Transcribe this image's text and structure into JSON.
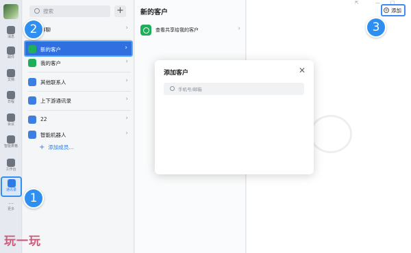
{
  "rail": {
    "items": [
      {
        "label": "消息",
        "icon": "chat-icon"
      },
      {
        "label": "邮件",
        "icon": "mail-icon"
      },
      {
        "label": "文档",
        "icon": "doc-icon"
      },
      {
        "label": "日程",
        "icon": "calendar-icon"
      },
      {
        "label": "会议",
        "icon": "meeting-icon"
      },
      {
        "label": "智能表格",
        "icon": "table-icon"
      },
      {
        "label": "工作台",
        "icon": "grid-icon"
      },
      {
        "label": "通讯录",
        "icon": "contacts-icon"
      }
    ],
    "more_label": "更多"
  },
  "contacts": {
    "search_placeholder": "搜索",
    "add_symbol": "+",
    "rows": [
      {
        "label": "群聊"
      },
      {
        "label": "新的客户"
      },
      {
        "label": "我的客户"
      },
      {
        "label": "其他联系人"
      },
      {
        "label": "上下游通讯录"
      },
      {
        "label": "22"
      },
      {
        "label": "智能机器人"
      }
    ],
    "add_member": "添加成员..."
  },
  "middle": {
    "title": "新的客户",
    "row_label": "查看共享给我的客户"
  },
  "header": {
    "add_button": "添加"
  },
  "dialog": {
    "title": "添加客户",
    "input_placeholder": "手机号/邮箱"
  },
  "steps": [
    "1",
    "2",
    "3"
  ],
  "brand": "玩一玩",
  "colors": {
    "accent": "#2f8ff0",
    "selected_row": "#2f6fe0",
    "wechat_green": "#1fae5a"
  }
}
